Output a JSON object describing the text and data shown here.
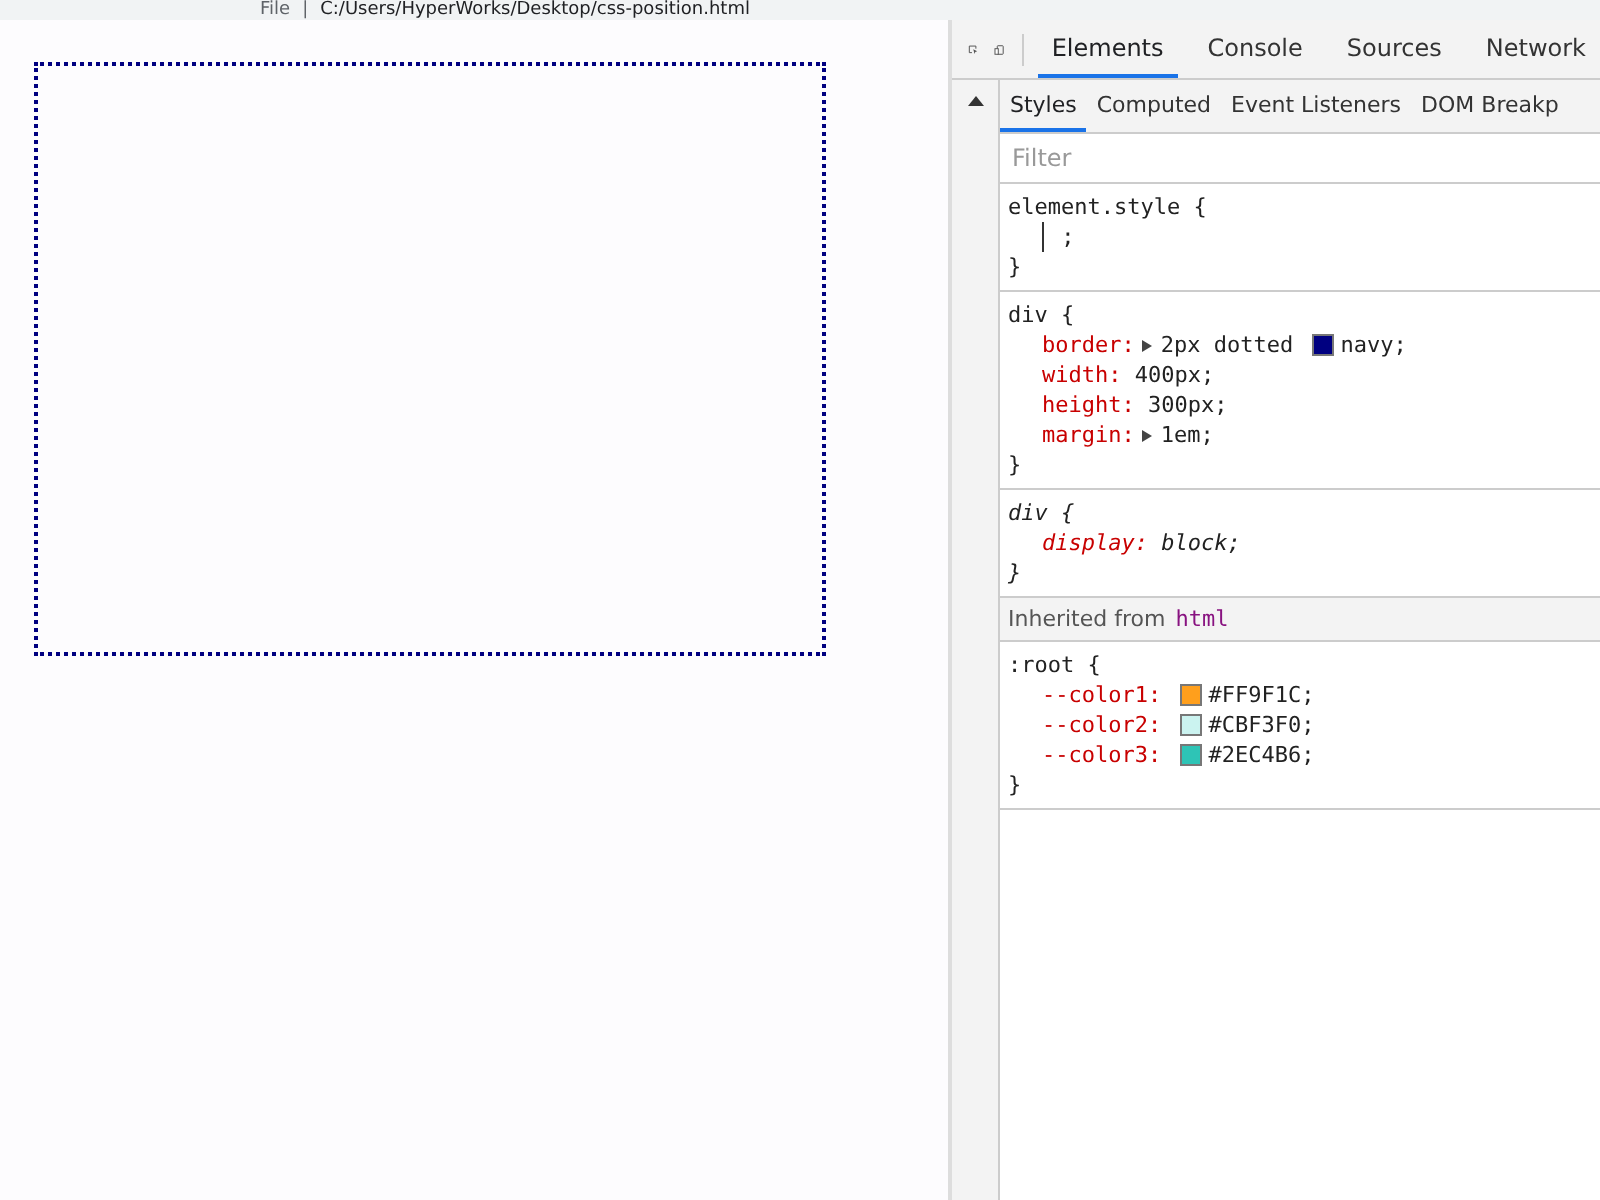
{
  "address_bar": {
    "scheme": "File",
    "separator": "|",
    "url": "C:/Users/HyperWorks/Desktop/css-position.html"
  },
  "devtools": {
    "tabs": [
      {
        "label": "Elements",
        "selected": true
      },
      {
        "label": "Console",
        "selected": false
      },
      {
        "label": "Sources",
        "selected": false
      },
      {
        "label": "Network",
        "selected": false
      }
    ],
    "subtabs": [
      {
        "label": "Styles",
        "selected": true
      },
      {
        "label": "Computed",
        "selected": false
      },
      {
        "label": "Event Listeners",
        "selected": false
      },
      {
        "label": "DOM Breakp",
        "selected": false
      }
    ],
    "filter": {
      "placeholder": "Filter"
    },
    "rules": [
      {
        "kind": "rule",
        "selector": "element.style {",
        "user_agent": false,
        "close": "}",
        "properties": [
          {
            "value": ";",
            "expandable": false
          }
        ]
      },
      {
        "kind": "rule",
        "selector": "div {",
        "user_agent": false,
        "close": "}",
        "properties": [
          {
            "name": "border:",
            "value": "2px dotted",
            "expandable": true,
            "color": "#000080",
            "after": "navy;"
          },
          {
            "name": "width:",
            "value": "400px;",
            "expandable": false
          },
          {
            "name": "height:",
            "value": "300px;",
            "expandable": false
          },
          {
            "name": "margin:",
            "value": "1em;",
            "expandable": true
          }
        ]
      },
      {
        "kind": "rule",
        "selector": "div {",
        "user_agent": true,
        "close": "}",
        "properties": [
          {
            "name": "display:",
            "value": "block;",
            "expandable": false
          }
        ]
      },
      {
        "kind": "inherited",
        "label": "Inherited from",
        "element": "html"
      },
      {
        "kind": "rule",
        "selector": ":root {",
        "user_agent": false,
        "close": "}",
        "properties": [
          {
            "name": "--color1:",
            "expandable": false,
            "color": "#ff9f1c",
            "after": "#FF9F1C;"
          },
          {
            "name": "--color2:",
            "expandable": false,
            "color": "#cbf3f0",
            "after": "#CBF3F0;"
          },
          {
            "name": "--color3:",
            "expandable": false,
            "color": "#2ec4b6",
            "after": "#2EC4B6;"
          }
        ]
      }
    ]
  }
}
